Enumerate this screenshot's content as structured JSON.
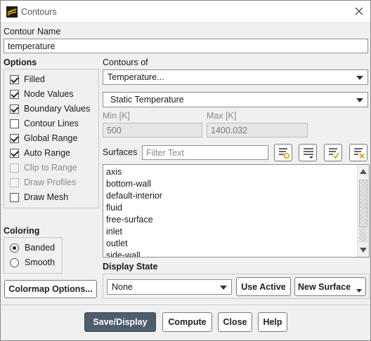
{
  "window": {
    "title": "Contours"
  },
  "contour_name": {
    "label": "Contour Name",
    "value": "temperature"
  },
  "options": {
    "heading": "Options",
    "items": [
      {
        "label": "Filled",
        "checked": true,
        "enabled": true
      },
      {
        "label": "Node Values",
        "checked": true,
        "enabled": true
      },
      {
        "label": "Boundary Values",
        "checked": true,
        "enabled": true
      },
      {
        "label": "Contour Lines",
        "checked": false,
        "enabled": true
      },
      {
        "label": "Global Range",
        "checked": true,
        "enabled": true
      },
      {
        "label": "Auto Range",
        "checked": true,
        "enabled": true
      },
      {
        "label": "Clip to Range",
        "checked": false,
        "enabled": false
      },
      {
        "label": "Draw Profiles",
        "checked": false,
        "enabled": false
      },
      {
        "label": "Draw Mesh",
        "checked": false,
        "enabled": true
      }
    ]
  },
  "coloring": {
    "heading": "Coloring",
    "options": [
      {
        "label": "Banded",
        "selected": true
      },
      {
        "label": "Smooth",
        "selected": false
      }
    ],
    "colormap_button": "Colormap Options..."
  },
  "contours_of": {
    "label": "Contours of",
    "category": "Temperature...",
    "variable": "Static Temperature",
    "min_label": "Min [K]",
    "min_value": "500",
    "max_label": "Max [K]",
    "max_value": "1400.032"
  },
  "surfaces": {
    "label": "Surfaces",
    "filter_placeholder": "Filter Text",
    "tool_icons": [
      "new-surface-list-icon",
      "select-all-icon",
      "filter-check-icon",
      "deselect-all-icon"
    ],
    "items": [
      "axis",
      "bottom-wall",
      "default-interior",
      "fluid",
      "free-surface",
      "inlet",
      "outlet",
      "side-wall"
    ]
  },
  "display_state": {
    "heading": "Display State",
    "value": "None",
    "use_active": "Use Active",
    "new_surface": "New Surface"
  },
  "footer": {
    "save_display": "Save/Display",
    "compute": "Compute",
    "close": "Close",
    "help": "Help"
  },
  "colors": {
    "primary_button": "#4e5d6c",
    "window_bg": "#f0f0f0"
  }
}
